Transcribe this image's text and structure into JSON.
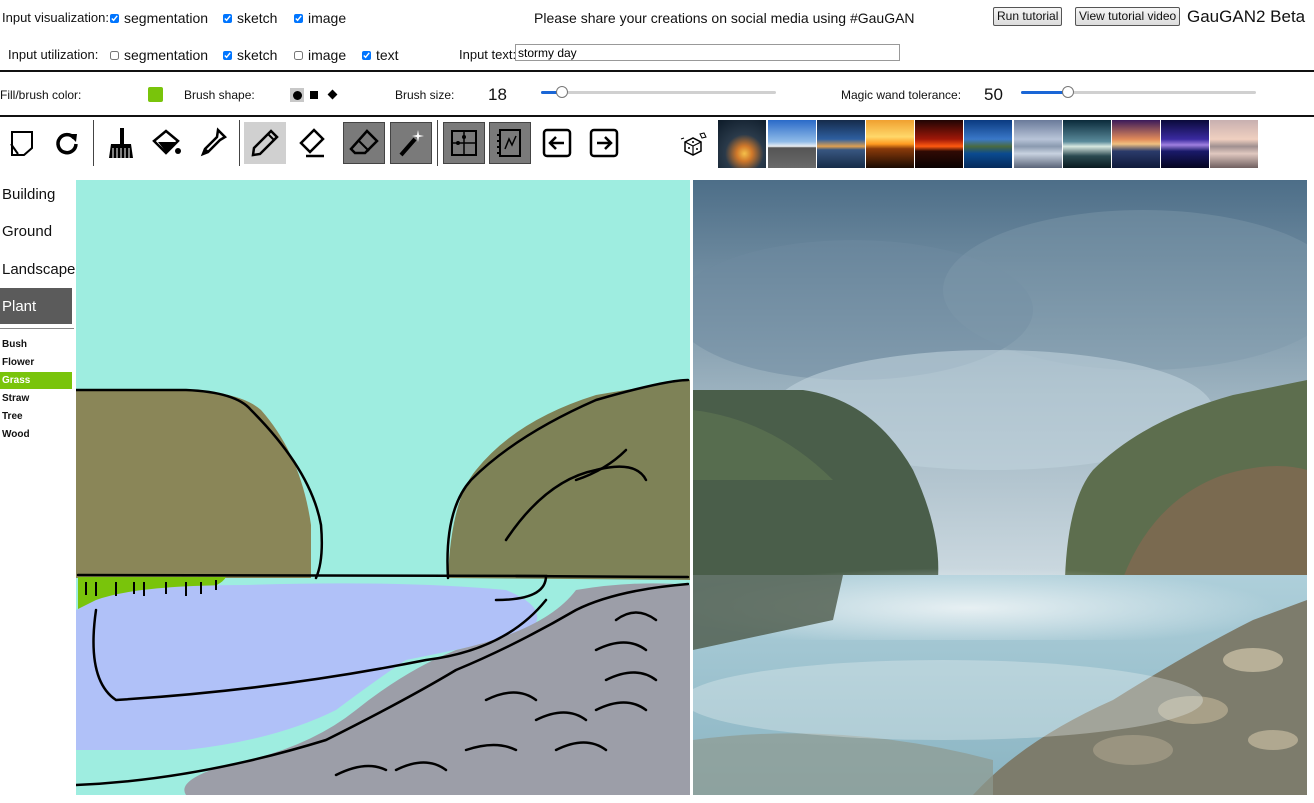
{
  "header": {
    "input_visualization_label": "Input visualization:",
    "input_utilization_label": "Input utilization:",
    "visualization_options": [
      {
        "label": "segmentation",
        "checked": true
      },
      {
        "label": "sketch",
        "checked": true
      },
      {
        "label": "image",
        "checked": true
      }
    ],
    "utilization_options": [
      {
        "label": "segmentation",
        "checked": false
      },
      {
        "label": "sketch",
        "checked": true
      },
      {
        "label": "image",
        "checked": false
      },
      {
        "label": "text",
        "checked": true
      }
    ],
    "share_message": "Please share your creations on social media using #GauGAN",
    "run_tutorial": "Run tutorial",
    "view_tutorial_video": "View tutorial video",
    "app_title": "GauGAN2 Beta",
    "input_text_label": "Input text:",
    "input_text_value": "stormy day"
  },
  "brush_bar": {
    "fill_label": "Fill/brush color:",
    "fill_color": "#79c40b",
    "brush_shape_label": "Brush shape:",
    "brush_shapes": [
      "circle",
      "square",
      "diamond"
    ],
    "brush_size_label": "Brush size:",
    "brush_size": "18",
    "brush_size_fraction": 0.09,
    "magic_wand_label": "Magic wand tolerance:",
    "magic_wand_value": "50",
    "magic_wand_fraction": 0.2
  },
  "toolbar": {
    "tools": [
      "new-canvas-icon",
      "rotate-icon",
      "broom-icon",
      "paint-bucket-icon",
      "eyedropper-icon",
      "pencil-icon",
      "eraser-line-icon",
      "eraser-icon",
      "magic-wand-icon",
      "puzzle-icon",
      "notebook-icon",
      "arrow-left-icon",
      "arrow-right-icon",
      "dice-icon"
    ],
    "example_thumbnails": 11
  },
  "categories": {
    "main": [
      "Building",
      "Ground",
      "Landscape",
      "Plant"
    ],
    "active_main": "Plant",
    "sub": [
      "Bush",
      "Flower",
      "Grass",
      "Straw",
      "Tree",
      "Wood"
    ],
    "active_sub": "Grass"
  },
  "colors": {
    "sky": "#9eede0",
    "hill": "#8a8658",
    "hill_right": "#7e8257",
    "water": "#b0c1f8",
    "rock": "#9c9ea8",
    "grass": "#79c40b",
    "accent": "#1a66d6"
  }
}
